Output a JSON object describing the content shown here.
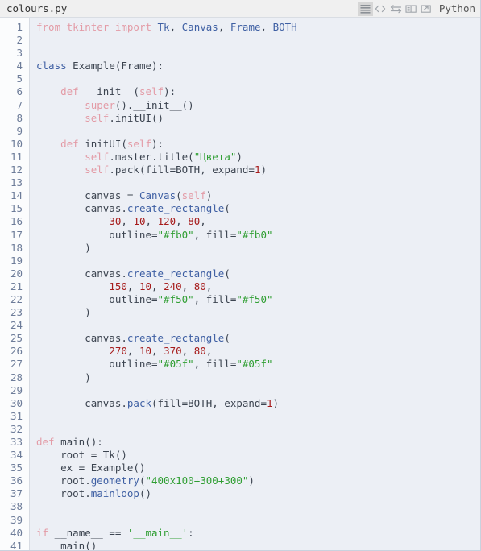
{
  "titlebar": {
    "filename": "colours.py",
    "language_label": "Python",
    "icons": [
      {
        "name": "lines-icon",
        "active": true
      },
      {
        "name": "code-brackets-icon",
        "active": false
      },
      {
        "name": "wrap-lines-icon",
        "active": false
      },
      {
        "name": "duplicate-panel-icon",
        "active": false
      },
      {
        "name": "open-external-icon",
        "active": false
      }
    ]
  },
  "editor": {
    "first_line_number": 1,
    "total_lines": 41,
    "language": "Python",
    "colors": {
      "background": "#eceff5",
      "gutter_background": "#fbfcfd",
      "titlebar_background": "#f0f0f0",
      "keyword": "#e39ba6",
      "identifier_blue": "#3e5fa3",
      "string": "#2f9e32",
      "number": "#a61b1b",
      "text": "#3c4450",
      "line_number": "#6d7c99"
    },
    "lines": [
      {
        "n": 1,
        "tokens": [
          {
            "c": "kw",
            "t": "from"
          },
          {
            "c": "kw",
            "t": " tkinter "
          },
          {
            "c": "kw",
            "t": "import"
          },
          {
            "c": "plain",
            "t": " "
          },
          {
            "c": "blue",
            "t": "Tk"
          },
          {
            "c": "plain",
            "t": ", "
          },
          {
            "c": "blue",
            "t": "Canvas"
          },
          {
            "c": "plain",
            "t": ", "
          },
          {
            "c": "blue",
            "t": "Frame"
          },
          {
            "c": "plain",
            "t": ", "
          },
          {
            "c": "blue",
            "t": "BOTH"
          }
        ]
      },
      {
        "n": 2,
        "tokens": []
      },
      {
        "n": 3,
        "tokens": []
      },
      {
        "n": 4,
        "tokens": [
          {
            "c": "blue",
            "t": "class"
          },
          {
            "c": "plain",
            "t": " "
          },
          {
            "c": "plain",
            "t": "Example"
          },
          {
            "c": "plain",
            "t": "("
          },
          {
            "c": "plain",
            "t": "Frame"
          },
          {
            "c": "plain",
            "t": "):"
          }
        ]
      },
      {
        "n": 5,
        "tokens": []
      },
      {
        "n": 6,
        "tokens": [
          {
            "c": "plain",
            "t": "    "
          },
          {
            "c": "kw",
            "t": "def"
          },
          {
            "c": "plain",
            "t": " __init__("
          },
          {
            "c": "self",
            "t": "self"
          },
          {
            "c": "plain",
            "t": "):"
          }
        ]
      },
      {
        "n": 7,
        "tokens": [
          {
            "c": "plain",
            "t": "        "
          },
          {
            "c": "kw",
            "t": "super"
          },
          {
            "c": "plain",
            "t": "().__init__()"
          }
        ]
      },
      {
        "n": 8,
        "tokens": [
          {
            "c": "plain",
            "t": "        "
          },
          {
            "c": "self",
            "t": "self"
          },
          {
            "c": "plain",
            "t": ".initUI()"
          }
        ]
      },
      {
        "n": 9,
        "tokens": []
      },
      {
        "n": 10,
        "tokens": [
          {
            "c": "plain",
            "t": "    "
          },
          {
            "c": "kw",
            "t": "def"
          },
          {
            "c": "plain",
            "t": " initUI("
          },
          {
            "c": "self",
            "t": "self"
          },
          {
            "c": "plain",
            "t": "):"
          }
        ]
      },
      {
        "n": 11,
        "tokens": [
          {
            "c": "plain",
            "t": "        "
          },
          {
            "c": "self",
            "t": "self"
          },
          {
            "c": "plain",
            "t": ".master.title("
          },
          {
            "c": "str",
            "t": "\"Цвета\""
          },
          {
            "c": "plain",
            "t": ")"
          }
        ]
      },
      {
        "n": 12,
        "tokens": [
          {
            "c": "plain",
            "t": "        "
          },
          {
            "c": "self",
            "t": "self"
          },
          {
            "c": "plain",
            "t": ".pack(fill=BOTH, expand="
          },
          {
            "c": "num",
            "t": "1"
          },
          {
            "c": "plain",
            "t": ")"
          }
        ]
      },
      {
        "n": 13,
        "tokens": []
      },
      {
        "n": 14,
        "tokens": [
          {
            "c": "plain",
            "t": "        canvas = "
          },
          {
            "c": "blue",
            "t": "Canvas"
          },
          {
            "c": "plain",
            "t": "("
          },
          {
            "c": "self",
            "t": "self"
          },
          {
            "c": "plain",
            "t": ")"
          }
        ]
      },
      {
        "n": 15,
        "tokens": [
          {
            "c": "plain",
            "t": "        canvas."
          },
          {
            "c": "fn",
            "t": "create_rectangle"
          },
          {
            "c": "plain",
            "t": "("
          }
        ]
      },
      {
        "n": 16,
        "tokens": [
          {
            "c": "plain",
            "t": "            "
          },
          {
            "c": "num",
            "t": "30"
          },
          {
            "c": "plain",
            "t": ", "
          },
          {
            "c": "num",
            "t": "10"
          },
          {
            "c": "plain",
            "t": ", "
          },
          {
            "c": "num",
            "t": "120"
          },
          {
            "c": "plain",
            "t": ", "
          },
          {
            "c": "num",
            "t": "80"
          },
          {
            "c": "plain",
            "t": ","
          }
        ]
      },
      {
        "n": 17,
        "tokens": [
          {
            "c": "plain",
            "t": "            outline="
          },
          {
            "c": "str",
            "t": "\"#fb0\""
          },
          {
            "c": "plain",
            "t": ", fill="
          },
          {
            "c": "str",
            "t": "\"#fb0\""
          }
        ]
      },
      {
        "n": 18,
        "tokens": [
          {
            "c": "plain",
            "t": "        )"
          }
        ]
      },
      {
        "n": 19,
        "tokens": []
      },
      {
        "n": 20,
        "tokens": [
          {
            "c": "plain",
            "t": "        canvas."
          },
          {
            "c": "fn",
            "t": "create_rectangle"
          },
          {
            "c": "plain",
            "t": "("
          }
        ]
      },
      {
        "n": 21,
        "tokens": [
          {
            "c": "plain",
            "t": "            "
          },
          {
            "c": "num",
            "t": "150"
          },
          {
            "c": "plain",
            "t": ", "
          },
          {
            "c": "num",
            "t": "10"
          },
          {
            "c": "plain",
            "t": ", "
          },
          {
            "c": "num",
            "t": "240"
          },
          {
            "c": "plain",
            "t": ", "
          },
          {
            "c": "num",
            "t": "80"
          },
          {
            "c": "plain",
            "t": ","
          }
        ]
      },
      {
        "n": 22,
        "tokens": [
          {
            "c": "plain",
            "t": "            outline="
          },
          {
            "c": "str",
            "t": "\"#f50\""
          },
          {
            "c": "plain",
            "t": ", fill="
          },
          {
            "c": "str",
            "t": "\"#f50\""
          }
        ]
      },
      {
        "n": 23,
        "tokens": [
          {
            "c": "plain",
            "t": "        )"
          }
        ]
      },
      {
        "n": 24,
        "tokens": []
      },
      {
        "n": 25,
        "tokens": [
          {
            "c": "plain",
            "t": "        canvas."
          },
          {
            "c": "fn",
            "t": "create_rectangle"
          },
          {
            "c": "plain",
            "t": "("
          }
        ]
      },
      {
        "n": 26,
        "tokens": [
          {
            "c": "plain",
            "t": "            "
          },
          {
            "c": "num",
            "t": "270"
          },
          {
            "c": "plain",
            "t": ", "
          },
          {
            "c": "num",
            "t": "10"
          },
          {
            "c": "plain",
            "t": ", "
          },
          {
            "c": "num",
            "t": "370"
          },
          {
            "c": "plain",
            "t": ", "
          },
          {
            "c": "num",
            "t": "80"
          },
          {
            "c": "plain",
            "t": ","
          }
        ]
      },
      {
        "n": 27,
        "tokens": [
          {
            "c": "plain",
            "t": "            outline="
          },
          {
            "c": "str",
            "t": "\"#05f\""
          },
          {
            "c": "plain",
            "t": ", fill="
          },
          {
            "c": "str",
            "t": "\"#05f\""
          }
        ]
      },
      {
        "n": 28,
        "tokens": [
          {
            "c": "plain",
            "t": "        )"
          }
        ]
      },
      {
        "n": 29,
        "tokens": []
      },
      {
        "n": 30,
        "tokens": [
          {
            "c": "plain",
            "t": "        canvas."
          },
          {
            "c": "fn",
            "t": "pack"
          },
          {
            "c": "plain",
            "t": "(fill=BOTH, expand="
          },
          {
            "c": "num",
            "t": "1"
          },
          {
            "c": "plain",
            "t": ")"
          }
        ]
      },
      {
        "n": 31,
        "tokens": []
      },
      {
        "n": 32,
        "tokens": []
      },
      {
        "n": 33,
        "tokens": [
          {
            "c": "kw",
            "t": "def"
          },
          {
            "c": "plain",
            "t": " main():"
          }
        ]
      },
      {
        "n": 34,
        "tokens": [
          {
            "c": "plain",
            "t": "    root = Tk()"
          }
        ]
      },
      {
        "n": 35,
        "tokens": [
          {
            "c": "plain",
            "t": "    ex = Example()"
          }
        ]
      },
      {
        "n": 36,
        "tokens": [
          {
            "c": "plain",
            "t": "    root."
          },
          {
            "c": "fn",
            "t": "geometry"
          },
          {
            "c": "plain",
            "t": "("
          },
          {
            "c": "str",
            "t": "\"400x100+300+300\""
          },
          {
            "c": "plain",
            "t": ")"
          }
        ]
      },
      {
        "n": 37,
        "tokens": [
          {
            "c": "plain",
            "t": "    root."
          },
          {
            "c": "fn",
            "t": "mainloop"
          },
          {
            "c": "plain",
            "t": "()"
          }
        ]
      },
      {
        "n": 38,
        "tokens": []
      },
      {
        "n": 39,
        "tokens": []
      },
      {
        "n": 40,
        "tokens": [
          {
            "c": "kw",
            "t": "if"
          },
          {
            "c": "plain",
            "t": " __name__ == "
          },
          {
            "c": "str",
            "t": "'__main__'"
          },
          {
            "c": "plain",
            "t": ":"
          }
        ]
      },
      {
        "n": 41,
        "tokens": [
          {
            "c": "plain",
            "t": "    main()"
          }
        ]
      }
    ]
  }
}
